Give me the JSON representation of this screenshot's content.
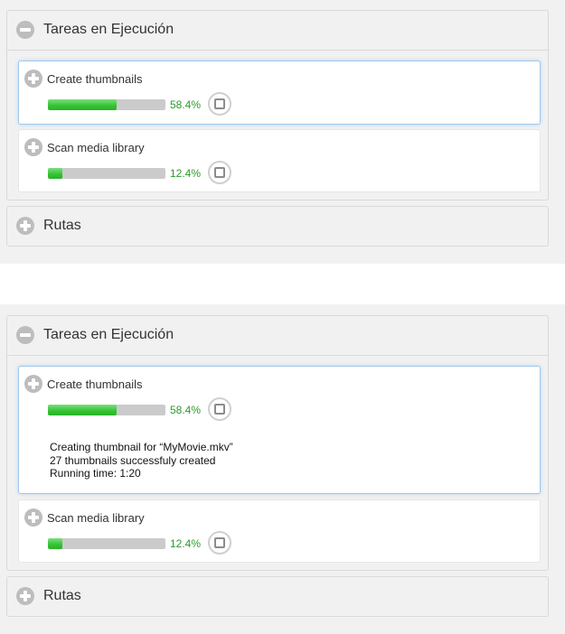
{
  "states": [
    {
      "running_tasks": {
        "title": "Tareas en Ejecución",
        "tasks": [
          {
            "name": "Create thumbnails",
            "progress_percent": 58.4,
            "progress_label": "58.4%",
            "expanded": false,
            "selected": true
          },
          {
            "name": "Scan media library",
            "progress_percent": 12.4,
            "progress_label": "12.4%",
            "expanded": false,
            "selected": false
          }
        ]
      },
      "routes": {
        "title": "Rutas"
      }
    },
    {
      "running_tasks": {
        "title": "Tareas en Ejecución",
        "tasks": [
          {
            "name": "Create thumbnails",
            "progress_percent": 58.4,
            "progress_label": "58.4%",
            "expanded": true,
            "selected": true,
            "details": [
              "Creating thumbnail for “MyMovie.mkv”",
              "27 thumbnails successfuly created",
              "Running time: 1:20"
            ]
          },
          {
            "name": "Scan media library",
            "progress_percent": 12.4,
            "progress_label": "12.4%",
            "expanded": false,
            "selected": false
          }
        ]
      },
      "routes": {
        "title": "Rutas"
      }
    }
  ],
  "colors": {
    "progress_fill": "#33c233",
    "progress_track": "#cbcbcb",
    "percent_text": "#2a9a2a",
    "selected_border": "#9fc7ec",
    "icon_circle": "#bdbdbd"
  },
  "icons": {
    "collapse": "minus-circle-icon",
    "expand": "plus-circle-icon",
    "stop": "stop-icon"
  }
}
